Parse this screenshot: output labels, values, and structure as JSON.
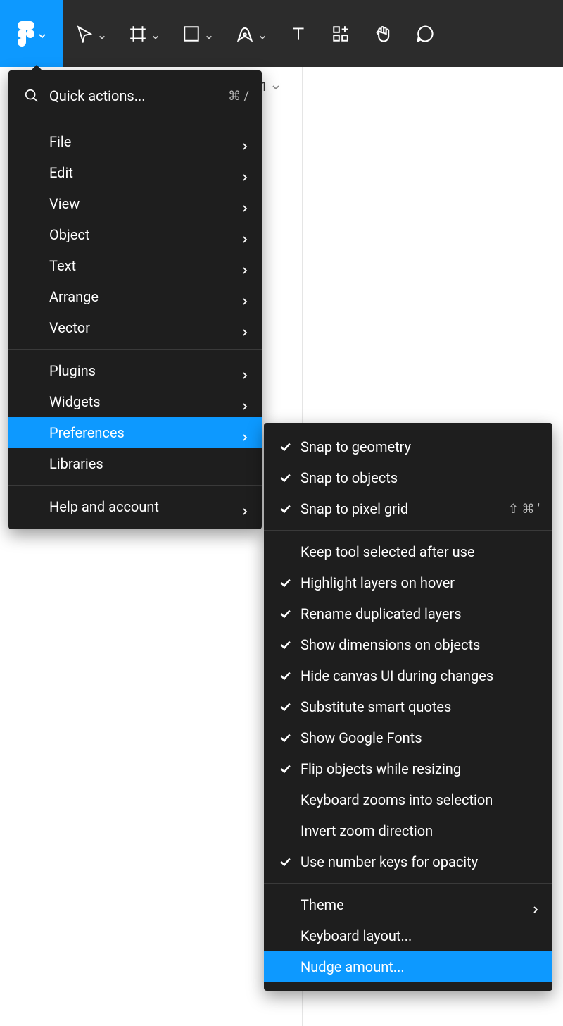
{
  "toolbar": {
    "tools": [
      "move",
      "frame",
      "shape",
      "pen",
      "text",
      "components",
      "hand",
      "comment"
    ]
  },
  "page_label": "1",
  "menu": {
    "quick_actions": "Quick actions...",
    "quick_shortcut": "⌘ /",
    "items": [
      {
        "label": "File",
        "submenu": true
      },
      {
        "label": "Edit",
        "submenu": true
      },
      {
        "label": "View",
        "submenu": true
      },
      {
        "label": "Object",
        "submenu": true
      },
      {
        "label": "Text",
        "submenu": true
      },
      {
        "label": "Arrange",
        "submenu": true
      },
      {
        "label": "Vector",
        "submenu": true
      }
    ],
    "items2": [
      {
        "label": "Plugins",
        "submenu": true
      },
      {
        "label": "Widgets",
        "submenu": true
      },
      {
        "label": "Preferences",
        "submenu": true,
        "highlight": true
      },
      {
        "label": "Libraries",
        "submenu": false
      }
    ],
    "items3": [
      {
        "label": "Help and account",
        "submenu": true
      }
    ]
  },
  "preferences": {
    "group1": [
      {
        "label": "Snap to geometry",
        "checked": true
      },
      {
        "label": "Snap to objects",
        "checked": true
      },
      {
        "label": "Snap to pixel grid",
        "checked": true,
        "shortcut": "⇧ ⌘ '"
      }
    ],
    "group2": [
      {
        "label": "Keep tool selected after use",
        "checked": false
      },
      {
        "label": "Highlight layers on hover",
        "checked": true
      },
      {
        "label": "Rename duplicated layers",
        "checked": true
      },
      {
        "label": "Show dimensions on objects",
        "checked": true
      },
      {
        "label": "Hide canvas UI during changes",
        "checked": true
      },
      {
        "label": "Substitute smart quotes",
        "checked": true
      },
      {
        "label": "Show Google Fonts",
        "checked": true
      },
      {
        "label": "Flip objects while resizing",
        "checked": true
      },
      {
        "label": "Keyboard zooms into selection",
        "checked": false
      },
      {
        "label": "Invert zoom direction",
        "checked": false
      },
      {
        "label": "Use number keys for opacity",
        "checked": true
      }
    ],
    "group3": [
      {
        "label": "Theme",
        "submenu": true
      },
      {
        "label": "Keyboard layout..."
      },
      {
        "label": "Nudge amount...",
        "highlight": true
      }
    ]
  }
}
